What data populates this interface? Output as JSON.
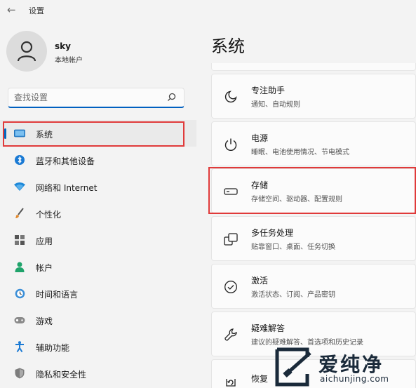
{
  "window": {
    "title": "设置"
  },
  "user": {
    "name": "sky",
    "account_type": "本地帐户"
  },
  "search": {
    "placeholder": "查找设置"
  },
  "sidebar": {
    "items": [
      {
        "label": "系统",
        "icon": "monitor-icon"
      },
      {
        "label": "蓝牙和其他设备",
        "icon": "bluetooth-icon"
      },
      {
        "label": "网络和 Internet",
        "icon": "wifi-icon"
      },
      {
        "label": "个性化",
        "icon": "brush-icon"
      },
      {
        "label": "应用",
        "icon": "apps-icon"
      },
      {
        "label": "帐户",
        "icon": "person-icon"
      },
      {
        "label": "时间和语言",
        "icon": "clock-globe-icon"
      },
      {
        "label": "游戏",
        "icon": "gamepad-icon"
      },
      {
        "label": "辅助功能",
        "icon": "accessibility-icon"
      },
      {
        "label": "隐私和安全性",
        "icon": "shield-icon"
      }
    ]
  },
  "main": {
    "title": "系统",
    "cards": [
      {
        "title": "专注助手",
        "subtitle": "通知、自动规则",
        "icon": "moon-icon"
      },
      {
        "title": "电源",
        "subtitle": "睡眠、电池使用情况、节电模式",
        "icon": "power-icon"
      },
      {
        "title": "存储",
        "subtitle": "存储空间、驱动器、配置规则",
        "icon": "storage-drive-icon"
      },
      {
        "title": "多任务处理",
        "subtitle": "贴靠窗口、桌面、任务切换",
        "icon": "multitask-icon"
      },
      {
        "title": "激活",
        "subtitle": "激活状态、订阅、产品密钥",
        "icon": "check-circle-icon"
      },
      {
        "title": "疑难解答",
        "subtitle": "建议的疑难解答、首选项和历史记录",
        "icon": "wrench-icon"
      },
      {
        "title": "恢复",
        "subtitle": "",
        "icon": "recovery-icon"
      }
    ]
  },
  "watermark": {
    "text": "爱纯净",
    "url": "aichunjing.com"
  },
  "colors": {
    "accent": "#0067c0",
    "highlight_box": "#e03a3a"
  }
}
